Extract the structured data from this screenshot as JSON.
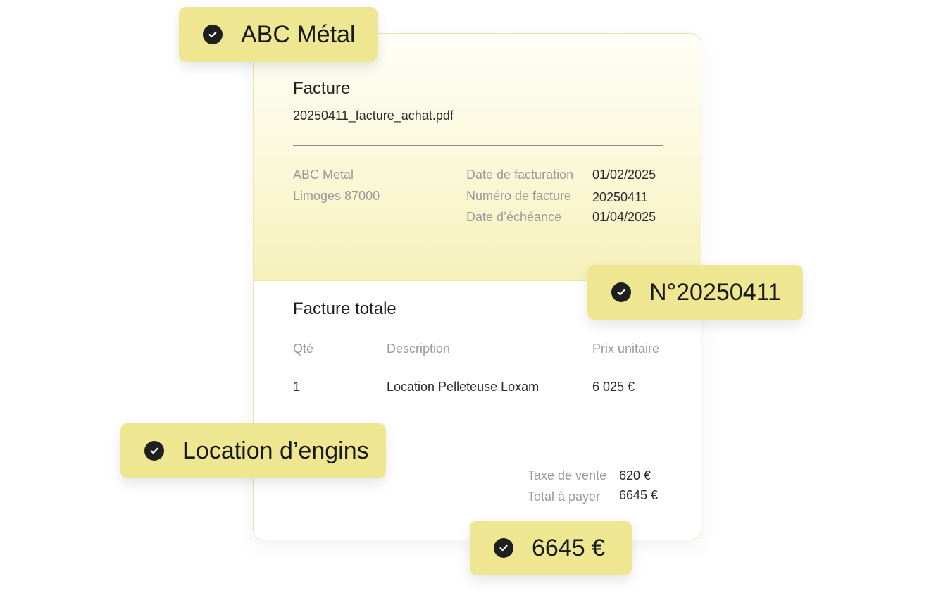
{
  "invoice": {
    "title": "Facture",
    "filename": "20250411_facture_achat.pdf",
    "vendor": {
      "name": "ABC Metal",
      "address": "Limoges 87000"
    },
    "details": [
      {
        "label": "Date de facturation",
        "value": "01/02/2025"
      },
      {
        "label": "Numéro de facture",
        "value": "20250411"
      },
      {
        "label": "Date d’échéance",
        "value": "01/04/2025"
      }
    ],
    "section_title": "Facture totale",
    "table": {
      "headers": [
        "Qté",
        "Description",
        "Prix unitaire"
      ],
      "rows": [
        [
          "1",
          "Location Pelleteuse Loxam",
          "6 025 €"
        ]
      ]
    },
    "summary": [
      {
        "label": "Taxe de vente",
        "value": "620 €"
      },
      {
        "label": "Total à payer",
        "value": "6645 €"
      }
    ]
  },
  "tags": {
    "supplier": "ABC Métal",
    "invoice_number": "N°20250411",
    "category": "Location d’engins",
    "amount": "6645 €"
  },
  "colors": {
    "tag_background": "#eee691",
    "icon": "#1f1f1f",
    "card_border": "#ece7a4"
  },
  "icons": {
    "tag_icon": "check-circle-icon"
  }
}
